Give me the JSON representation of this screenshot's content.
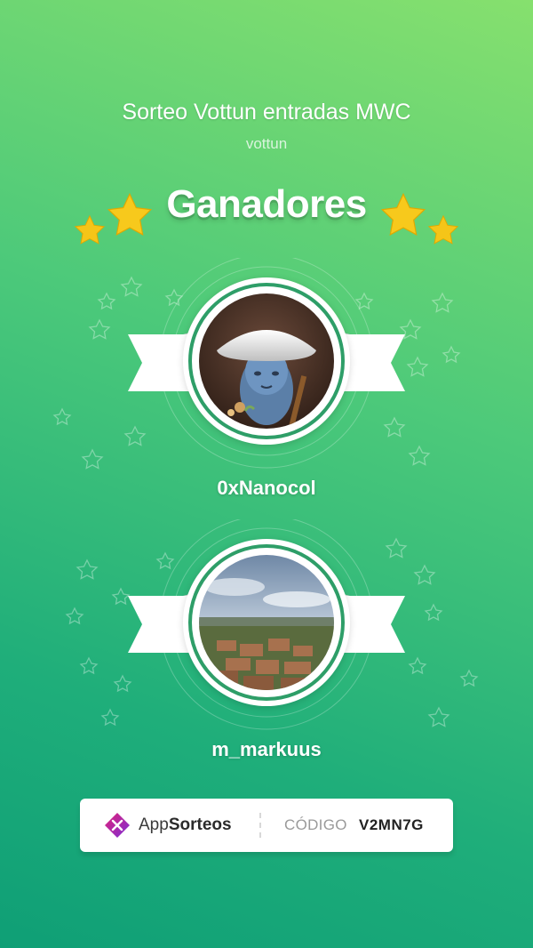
{
  "raffle": {
    "title": "Sorteo Vottun entradas MWC",
    "organizer": "vottun",
    "heading": "Ganadores"
  },
  "winners": [
    {
      "username": "0xNanocol",
      "avatar": "mushroom-creature-avatar"
    },
    {
      "username": "m_markuus",
      "avatar": "village-landscape-avatar"
    }
  ],
  "footer": {
    "brand_prefix": "App",
    "brand_suffix": "Sorteos",
    "code_label": "CÓDIGO",
    "code_value": "V2MN7G"
  },
  "colors": {
    "background_top": "#86e06e",
    "background_bottom": "#0f9f76",
    "ring": "#2e9e68",
    "star": "#f5c518",
    "logo_pink": "#e0237a",
    "logo_purple": "#7b2ed6"
  }
}
